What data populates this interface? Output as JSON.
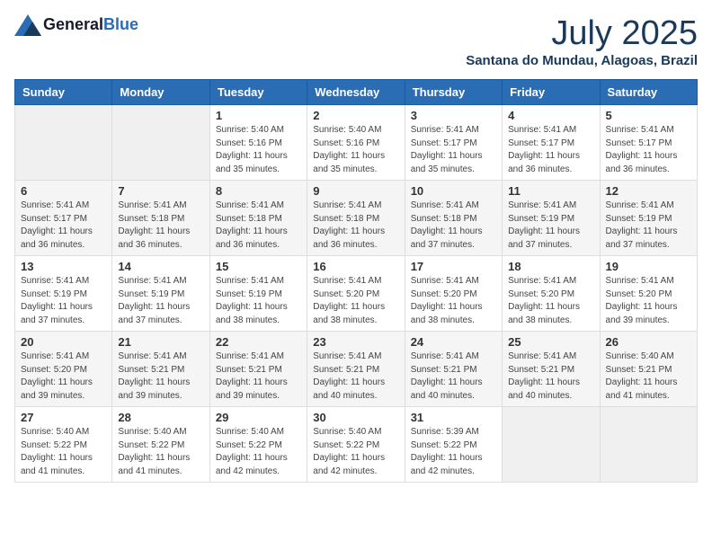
{
  "header": {
    "logo": {
      "general": "General",
      "blue": "Blue"
    },
    "title": "July 2025",
    "location": "Santana do Mundau, Alagoas, Brazil"
  },
  "days_header": [
    "Sunday",
    "Monday",
    "Tuesday",
    "Wednesday",
    "Thursday",
    "Friday",
    "Saturday"
  ],
  "weeks": [
    [
      {
        "day": "",
        "empty": true
      },
      {
        "day": "",
        "empty": true
      },
      {
        "day": "1",
        "sunrise": "Sunrise: 5:40 AM",
        "sunset": "Sunset: 5:16 PM",
        "daylight": "Daylight: 11 hours and 35 minutes."
      },
      {
        "day": "2",
        "sunrise": "Sunrise: 5:40 AM",
        "sunset": "Sunset: 5:16 PM",
        "daylight": "Daylight: 11 hours and 35 minutes."
      },
      {
        "day": "3",
        "sunrise": "Sunrise: 5:41 AM",
        "sunset": "Sunset: 5:17 PM",
        "daylight": "Daylight: 11 hours and 35 minutes."
      },
      {
        "day": "4",
        "sunrise": "Sunrise: 5:41 AM",
        "sunset": "Sunset: 5:17 PM",
        "daylight": "Daylight: 11 hours and 36 minutes."
      },
      {
        "day": "5",
        "sunrise": "Sunrise: 5:41 AM",
        "sunset": "Sunset: 5:17 PM",
        "daylight": "Daylight: 11 hours and 36 minutes."
      }
    ],
    [
      {
        "day": "6",
        "sunrise": "Sunrise: 5:41 AM",
        "sunset": "Sunset: 5:17 PM",
        "daylight": "Daylight: 11 hours and 36 minutes."
      },
      {
        "day": "7",
        "sunrise": "Sunrise: 5:41 AM",
        "sunset": "Sunset: 5:18 PM",
        "daylight": "Daylight: 11 hours and 36 minutes."
      },
      {
        "day": "8",
        "sunrise": "Sunrise: 5:41 AM",
        "sunset": "Sunset: 5:18 PM",
        "daylight": "Daylight: 11 hours and 36 minutes."
      },
      {
        "day": "9",
        "sunrise": "Sunrise: 5:41 AM",
        "sunset": "Sunset: 5:18 PM",
        "daylight": "Daylight: 11 hours and 36 minutes."
      },
      {
        "day": "10",
        "sunrise": "Sunrise: 5:41 AM",
        "sunset": "Sunset: 5:18 PM",
        "daylight": "Daylight: 11 hours and 37 minutes."
      },
      {
        "day": "11",
        "sunrise": "Sunrise: 5:41 AM",
        "sunset": "Sunset: 5:19 PM",
        "daylight": "Daylight: 11 hours and 37 minutes."
      },
      {
        "day": "12",
        "sunrise": "Sunrise: 5:41 AM",
        "sunset": "Sunset: 5:19 PM",
        "daylight": "Daylight: 11 hours and 37 minutes."
      }
    ],
    [
      {
        "day": "13",
        "sunrise": "Sunrise: 5:41 AM",
        "sunset": "Sunset: 5:19 PM",
        "daylight": "Daylight: 11 hours and 37 minutes."
      },
      {
        "day": "14",
        "sunrise": "Sunrise: 5:41 AM",
        "sunset": "Sunset: 5:19 PM",
        "daylight": "Daylight: 11 hours and 37 minutes."
      },
      {
        "day": "15",
        "sunrise": "Sunrise: 5:41 AM",
        "sunset": "Sunset: 5:19 PM",
        "daylight": "Daylight: 11 hours and 38 minutes."
      },
      {
        "day": "16",
        "sunrise": "Sunrise: 5:41 AM",
        "sunset": "Sunset: 5:20 PM",
        "daylight": "Daylight: 11 hours and 38 minutes."
      },
      {
        "day": "17",
        "sunrise": "Sunrise: 5:41 AM",
        "sunset": "Sunset: 5:20 PM",
        "daylight": "Daylight: 11 hours and 38 minutes."
      },
      {
        "day": "18",
        "sunrise": "Sunrise: 5:41 AM",
        "sunset": "Sunset: 5:20 PM",
        "daylight": "Daylight: 11 hours and 38 minutes."
      },
      {
        "day": "19",
        "sunrise": "Sunrise: 5:41 AM",
        "sunset": "Sunset: 5:20 PM",
        "daylight": "Daylight: 11 hours and 39 minutes."
      }
    ],
    [
      {
        "day": "20",
        "sunrise": "Sunrise: 5:41 AM",
        "sunset": "Sunset: 5:20 PM",
        "daylight": "Daylight: 11 hours and 39 minutes."
      },
      {
        "day": "21",
        "sunrise": "Sunrise: 5:41 AM",
        "sunset": "Sunset: 5:21 PM",
        "daylight": "Daylight: 11 hours and 39 minutes."
      },
      {
        "day": "22",
        "sunrise": "Sunrise: 5:41 AM",
        "sunset": "Sunset: 5:21 PM",
        "daylight": "Daylight: 11 hours and 39 minutes."
      },
      {
        "day": "23",
        "sunrise": "Sunrise: 5:41 AM",
        "sunset": "Sunset: 5:21 PM",
        "daylight": "Daylight: 11 hours and 40 minutes."
      },
      {
        "day": "24",
        "sunrise": "Sunrise: 5:41 AM",
        "sunset": "Sunset: 5:21 PM",
        "daylight": "Daylight: 11 hours and 40 minutes."
      },
      {
        "day": "25",
        "sunrise": "Sunrise: 5:41 AM",
        "sunset": "Sunset: 5:21 PM",
        "daylight": "Daylight: 11 hours and 40 minutes."
      },
      {
        "day": "26",
        "sunrise": "Sunrise: 5:40 AM",
        "sunset": "Sunset: 5:21 PM",
        "daylight": "Daylight: 11 hours and 41 minutes."
      }
    ],
    [
      {
        "day": "27",
        "sunrise": "Sunrise: 5:40 AM",
        "sunset": "Sunset: 5:22 PM",
        "daylight": "Daylight: 11 hours and 41 minutes."
      },
      {
        "day": "28",
        "sunrise": "Sunrise: 5:40 AM",
        "sunset": "Sunset: 5:22 PM",
        "daylight": "Daylight: 11 hours and 41 minutes."
      },
      {
        "day": "29",
        "sunrise": "Sunrise: 5:40 AM",
        "sunset": "Sunset: 5:22 PM",
        "daylight": "Daylight: 11 hours and 42 minutes."
      },
      {
        "day": "30",
        "sunrise": "Sunrise: 5:40 AM",
        "sunset": "Sunset: 5:22 PM",
        "daylight": "Daylight: 11 hours and 42 minutes."
      },
      {
        "day": "31",
        "sunrise": "Sunrise: 5:39 AM",
        "sunset": "Sunset: 5:22 PM",
        "daylight": "Daylight: 11 hours and 42 minutes."
      },
      {
        "day": "",
        "empty": true
      },
      {
        "day": "",
        "empty": true
      }
    ]
  ]
}
